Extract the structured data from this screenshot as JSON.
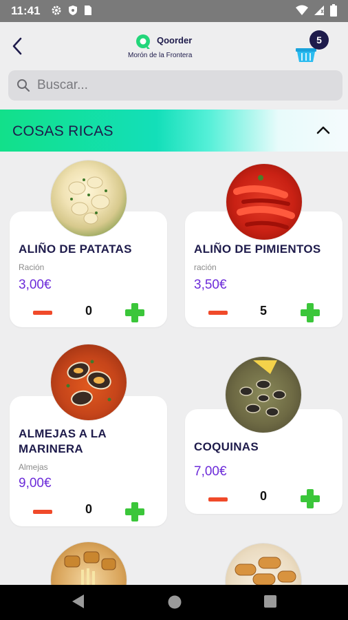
{
  "status_bar": {
    "time": "11:41"
  },
  "header": {
    "brand_name": "Qoorder",
    "city": "Morón de la Frontera",
    "cart_count": "5"
  },
  "search": {
    "placeholder": "Buscar..."
  },
  "category": {
    "title": "COSAS RICAS"
  },
  "products": [
    {
      "name": "ALIÑO DE PATATAS",
      "description": "Ración",
      "price": "3,00€",
      "quantity": "0"
    },
    {
      "name": "ALIÑO DE PIMIENTOS",
      "description": "ración",
      "price": "3,50€",
      "quantity": "5"
    },
    {
      "name": "ALMEJAS A LA MARINERA",
      "description": "Almejas",
      "price": "9,00€",
      "quantity": "0"
    },
    {
      "name": "COQUINAS",
      "description": "",
      "price": "7,00€",
      "quantity": "0"
    }
  ],
  "colors": {
    "brand_navy": "#1e1b4b",
    "price_purple": "#6c2bd9",
    "minus_red": "#f04a2a",
    "plus_green": "#3bc63a",
    "category_green": "#12e08a"
  },
  "icons": [
    "back-arrow-icon",
    "cart-basket-icon",
    "search-icon",
    "chevron-up-icon",
    "minus-icon",
    "plus-icon",
    "nav-back-icon",
    "nav-home-icon",
    "nav-recents-icon"
  ]
}
